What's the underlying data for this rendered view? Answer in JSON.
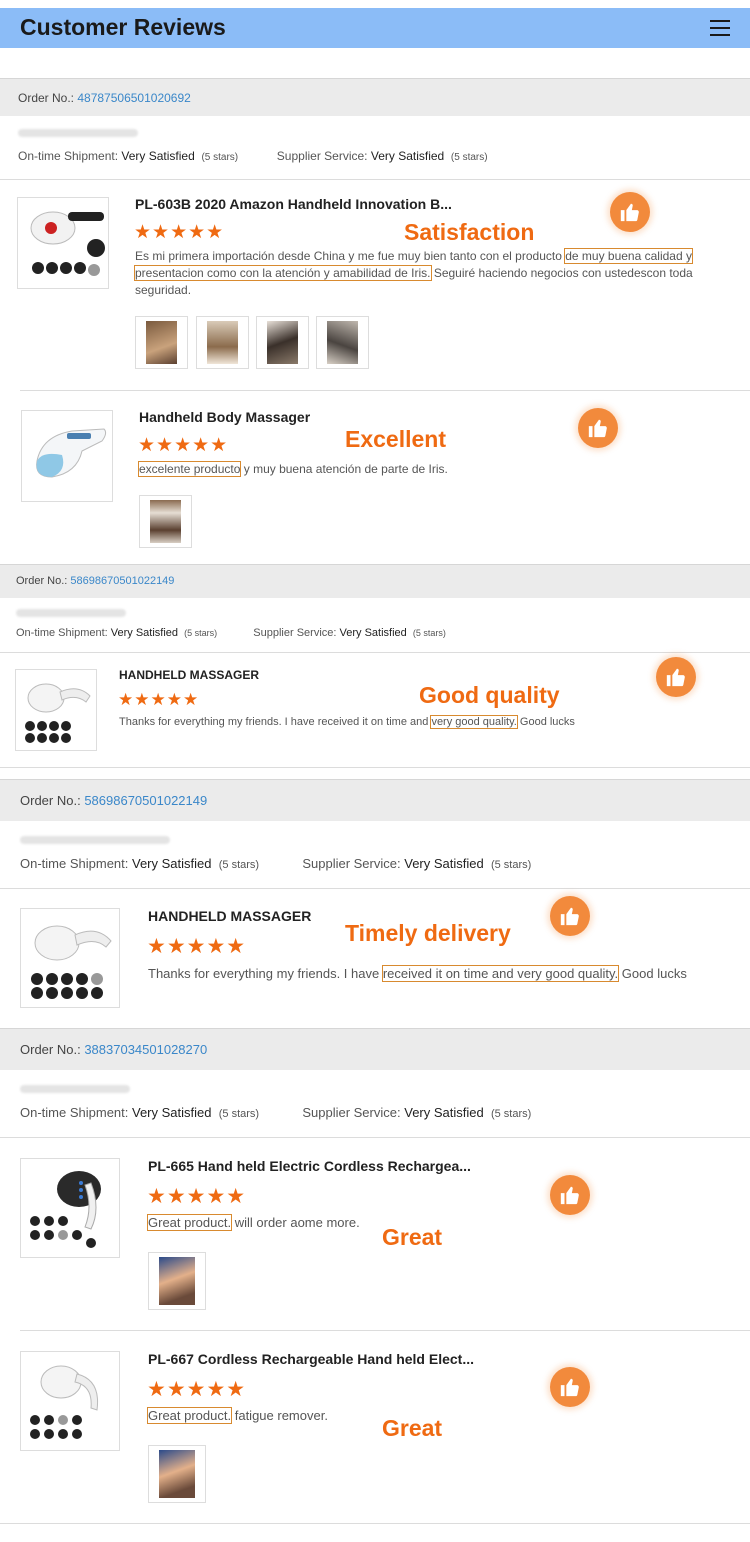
{
  "header": {
    "title": "Customer Reviews",
    "menu_icon": "menu-icon"
  },
  "orders": [
    {
      "label": "Order No.:",
      "number": "48787506501020692",
      "shipment_label": "On-time Shipment:",
      "shipment_value": "Very Satisfied",
      "shipment_stars": "(5 stars)",
      "supplier_label": "Supplier Service:",
      "supplier_value": "Very Satisfied",
      "supplier_stars": "(5 stars)"
    },
    {
      "label": "Order No.:",
      "number": "58698670501022149",
      "shipment_label": "On-time Shipment:",
      "shipment_value": "Very Satisfied",
      "shipment_stars": "(5 stars)",
      "supplier_label": "Supplier Service:",
      "supplier_value": "Very Satisfied",
      "supplier_stars": "(5 stars)"
    },
    {
      "label": "Order No.:",
      "number": "58698670501022149",
      "shipment_label": "On-time Shipment:",
      "shipment_value": "Very Satisfied",
      "shipment_stars": "(5 stars)",
      "supplier_label": "Supplier Service:",
      "supplier_value": "Very Satisfied",
      "supplier_stars": "(5 stars)"
    },
    {
      "label": "Order No.:",
      "number": "38837034501028270",
      "shipment_label": "On-time Shipment:",
      "shipment_value": "Very Satisfied",
      "shipment_stars": "(5 stars)",
      "supplier_label": "Supplier Service:",
      "supplier_value": "Very Satisfied",
      "supplier_stars": "(5 stars)"
    }
  ],
  "reviews": [
    {
      "title": "PL-603B 2020 Amazon Handheld Innovation B...",
      "stars": "★★★★★",
      "rating": 5,
      "text_before": "Es mi primera importación desde China y me fue muy bien tanto con el producto ",
      "text_highlight": "de muy buena calidad y presentacion como con la atención y amabilidad de Iris.",
      "text_after": " Seguiré haciendo negocios con ustedescon toda seguridad.",
      "tag": "Satisfaction"
    },
    {
      "title": "Handheld Body Massager",
      "stars": "★★★★★",
      "rating": 5,
      "text_before": "",
      "text_highlight": "excelente producto",
      "text_after": " y muy buena atención de parte de Iris.",
      "tag": "Excellent"
    },
    {
      "title": "HANDHELD MASSAGER",
      "stars": "★★★★★",
      "rating": 5,
      "text_before": "Thanks for everything my friends. I have received it on time and ",
      "text_highlight": "very good quality.",
      "text_after": " Good lucks",
      "tag": "Good quality"
    },
    {
      "title": "HANDHELD MASSAGER",
      "stars": "★★★★★",
      "rating": 5,
      "text_before": "Thanks for everything my friends. I have ",
      "text_highlight": "received it on time and very good quality.",
      "text_after": " Good lucks",
      "tag": "Timely delivery"
    },
    {
      "title": "PL-665 Hand held Electric Cordless Rechargea...",
      "stars": "★★★★★",
      "rating": 5,
      "text_before": "",
      "text_highlight": "Great product.",
      "text_after": " will order aome more.",
      "tag": "Great"
    },
    {
      "title": "PL-667 Cordless Rechargeable Hand held Elect...",
      "stars": "★★★★★",
      "rating": 5,
      "text_before": "",
      "text_highlight": "Great product.",
      "text_after": " fatigue remover.",
      "tag": "Great"
    }
  ],
  "colors": {
    "header_bg": "#8bbcf7",
    "accent": "#ef6a12",
    "link": "#3a87c9",
    "order_bar": "#ebebeb"
  },
  "icons": {
    "like": "thumbs-up-icon"
  }
}
